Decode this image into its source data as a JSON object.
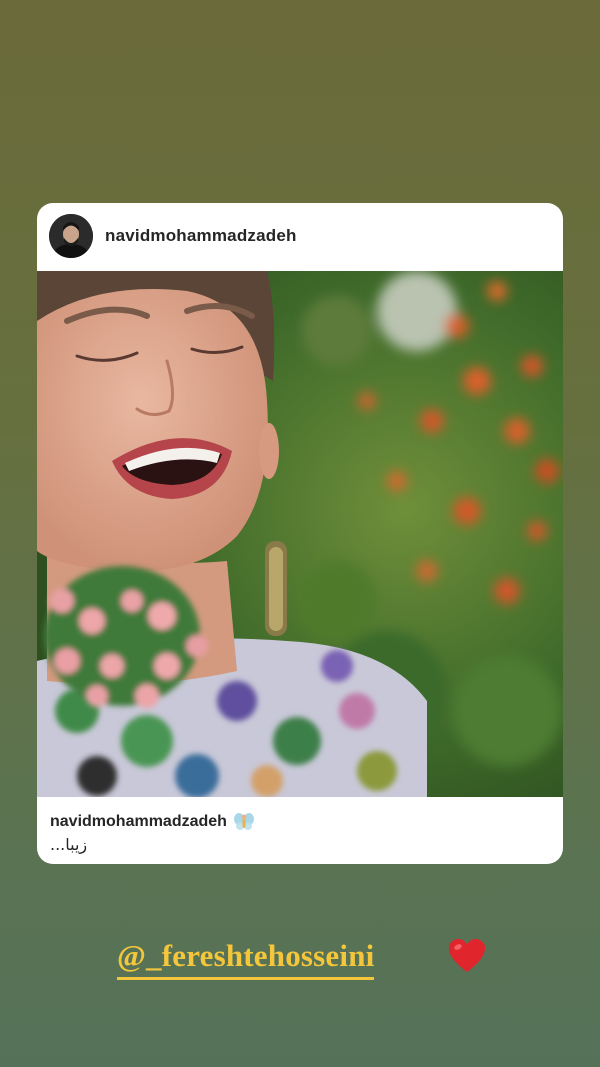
{
  "post": {
    "header_username": "navidmohammadzadeh",
    "photo_icon": "laughing-woman-photo",
    "caption_username": "navidmohammadzadeh",
    "caption_emoji_icon": "fairy-icon",
    "caption_text": "زیبا..."
  },
  "story": {
    "mention": "@_fereshtehosseini",
    "mention_color": "#f3c63c",
    "heart_icon": "red-heart-icon",
    "heart_color": "#e0252c"
  }
}
